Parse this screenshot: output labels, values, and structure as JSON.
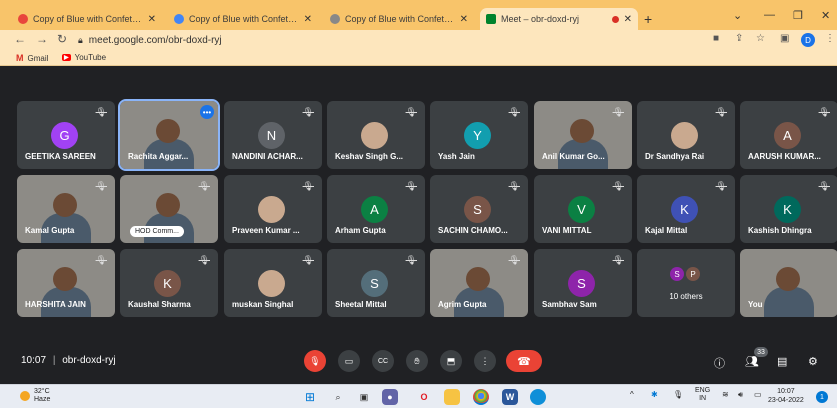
{
  "browser": {
    "tabs": [
      {
        "label": "Copy of Blue with Confetti Classr",
        "favicon_color": "#e8453c",
        "active": false
      },
      {
        "label": "Copy of Blue with Confetti Classr",
        "favicon_color": "#4285f4",
        "active": false
      },
      {
        "label": "Copy of Blue with Confetti Classr",
        "favicon_color": "#888888",
        "active": false
      },
      {
        "label": "Meet – obr-doxd-ryj",
        "favicon_color": "#00832d",
        "active": true
      }
    ],
    "url": "meet.google.com/obr-doxd-ryj",
    "profile_initial": "D",
    "bookmarks": [
      {
        "label": "Gmail",
        "icon": "gmail-icon"
      },
      {
        "label": "YouTube",
        "icon": "youtube-icon"
      }
    ]
  },
  "meet": {
    "participants": [
      {
        "name": "GEETIKA SAREEN",
        "initial": "G",
        "color": "#a142f4",
        "video": false
      },
      {
        "name": "Rachita Aggar...",
        "initial": "",
        "color": "",
        "video": true,
        "active": true
      },
      {
        "name": "NANDINI ACHAR...",
        "initial": "N",
        "color": "#5f6368",
        "video": false
      },
      {
        "name": "Keshav Singh G...",
        "initial": "",
        "color": "",
        "video": "photo"
      },
      {
        "name": "Yash Jain",
        "initial": "Y",
        "color": "#129eaf",
        "video": false
      },
      {
        "name": "Anil Kumar Go...",
        "initial": "",
        "color": "",
        "video": true
      },
      {
        "name": "Dr Sandhya Rai",
        "initial": "",
        "color": "",
        "video": "photo"
      },
      {
        "name": "AARUSH KUMAR...",
        "initial": "A",
        "color": "#795548",
        "video": false
      },
      {
        "name": "Kamal Gupta",
        "initial": "",
        "color": "",
        "video": true
      },
      {
        "name": "HOD Comm...",
        "initial": "",
        "color": "",
        "video": true,
        "chip": true
      },
      {
        "name": "Praveen Kumar ...",
        "initial": "",
        "color": "",
        "video": "photo"
      },
      {
        "name": "Arham Gupta",
        "initial": "A",
        "color": "#0b8043",
        "video": false
      },
      {
        "name": "SACHIN CHAMO...",
        "initial": "S",
        "color": "#795548",
        "video": false
      },
      {
        "name": "VANI MITTAL",
        "initial": "V",
        "color": "#0b8043",
        "video": false
      },
      {
        "name": "Kajal Mittal",
        "initial": "K",
        "color": "#3f51b5",
        "video": false
      },
      {
        "name": "Kashish Dhingra",
        "initial": "K",
        "color": "#00695c",
        "video": false
      },
      {
        "name": "HARSHITA JAIN",
        "initial": "",
        "color": "",
        "video": true
      },
      {
        "name": "Kaushal Sharma",
        "initial": "K",
        "color": "#795548",
        "video": false
      },
      {
        "name": "muskan Singhal",
        "initial": "",
        "color": "",
        "video": "photo"
      },
      {
        "name": "Sheetal Mittal",
        "initial": "S",
        "color": "#546e7a",
        "video": false
      },
      {
        "name": "Agrim Gupta",
        "initial": "",
        "color": "",
        "video": true
      },
      {
        "name": "Sambhav Sam",
        "initial": "S",
        "color": "#8e24aa",
        "video": false
      },
      {
        "name": "others",
        "initial": "",
        "color": "",
        "video": "others"
      },
      {
        "name": "You",
        "initial": "",
        "color": "",
        "video": true
      }
    ],
    "others": {
      "label": "10 others",
      "mini": [
        {
          "initial": "S",
          "color": "#8e24aa"
        },
        {
          "initial": "P",
          "color": "#795548"
        }
      ]
    },
    "time": "10:07",
    "separator": "|",
    "code": "obr-doxd-ryj",
    "people_count": "33"
  },
  "taskbar": {
    "temp": "32°C",
    "weather": "Haze",
    "lang": "ENG",
    "region": "IN",
    "time": "10:07",
    "date": "23-04-2022"
  }
}
